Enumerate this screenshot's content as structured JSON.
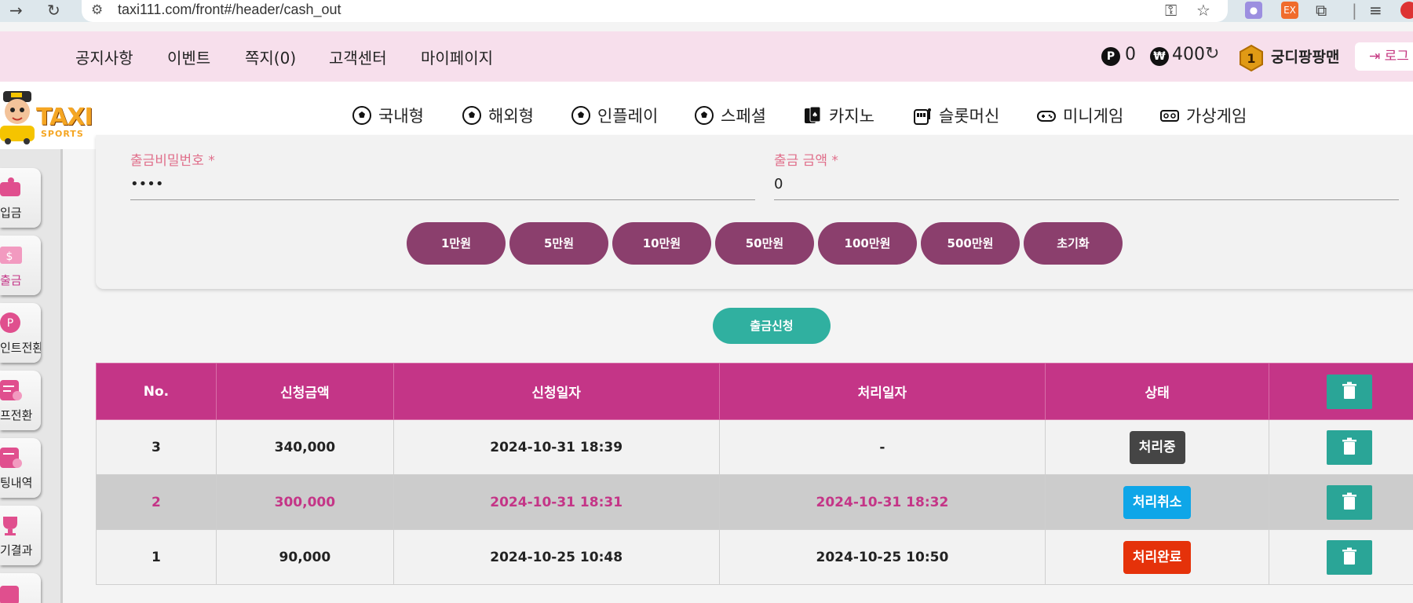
{
  "browser": {
    "url": "taxi111.com/front#/header/cash_out",
    "ext_badge": "EX"
  },
  "top_menu": {
    "links": [
      "공지사항",
      "이벤트",
      "쪽지(0)",
      "고객센터",
      "마이페이지"
    ],
    "point_symbol": "P",
    "point_value": "0",
    "money_symbol": "₩",
    "money_value": "400",
    "level": "1",
    "username": "궁디팡팡맨",
    "logout_label": "로그"
  },
  "logo": {
    "main": "TAXI",
    "sub": "SPORTS"
  },
  "main_nav": [
    {
      "label": "국내형",
      "icon": "soccer-ball-icon"
    },
    {
      "label": "해외형",
      "icon": "soccer-ball-icon"
    },
    {
      "label": "인플레이",
      "icon": "soccer-ball-icon"
    },
    {
      "label": "스페셜",
      "icon": "soccer-ball-icon"
    },
    {
      "label": "카지노",
      "icon": "playing-cards-icon"
    },
    {
      "label": "슬롯머신",
      "icon": "slot-machine-icon"
    },
    {
      "label": "미니게임",
      "icon": "gamepad-icon"
    },
    {
      "label": "가상게임",
      "icon": "vr-headset-icon"
    }
  ],
  "sidebar": [
    {
      "label": "입금",
      "icon": "wallet-icon"
    },
    {
      "label": "출금",
      "icon": "cash-icon"
    },
    {
      "label": "인트전환",
      "icon": "point-icon"
    },
    {
      "label": "프전환",
      "icon": "exchange-icon"
    },
    {
      "label": "팅내역",
      "icon": "history-icon"
    },
    {
      "label": "기결과",
      "icon": "trophy-icon"
    }
  ],
  "form": {
    "password_label": "출금비밀번호 *",
    "password_value": "••••",
    "amount_label": "출금 금액 *",
    "amount_value": "0",
    "amount_buttons": [
      "1만원",
      "5만원",
      "10만원",
      "50만원",
      "100만원",
      "500만원",
      "초기화"
    ],
    "submit_label": "출금신청"
  },
  "table": {
    "headers": [
      "No.",
      "신청금액",
      "신청일자",
      "처리일자",
      "상태"
    ],
    "rows": [
      {
        "no": "3",
        "amount": "340,000",
        "requested": "2024-10-31 18:39",
        "processed": "-",
        "status": "처리중"
      },
      {
        "no": "2",
        "amount": "300,000",
        "requested": "2024-10-31 18:31",
        "processed": "2024-10-31 18:32",
        "status": "처리취소"
      },
      {
        "no": "1",
        "amount": "90,000",
        "requested": "2024-10-25 10:48",
        "processed": "2024-10-25 10:50",
        "status": "처리완료"
      }
    ]
  },
  "colors": {
    "brand_pink": "#c43587",
    "amount_button": "#8b3f6d",
    "teal": "#2aa597",
    "status_processing": "#454545",
    "status_cancel": "#0ea6e8",
    "status_done": "#e5320a"
  }
}
